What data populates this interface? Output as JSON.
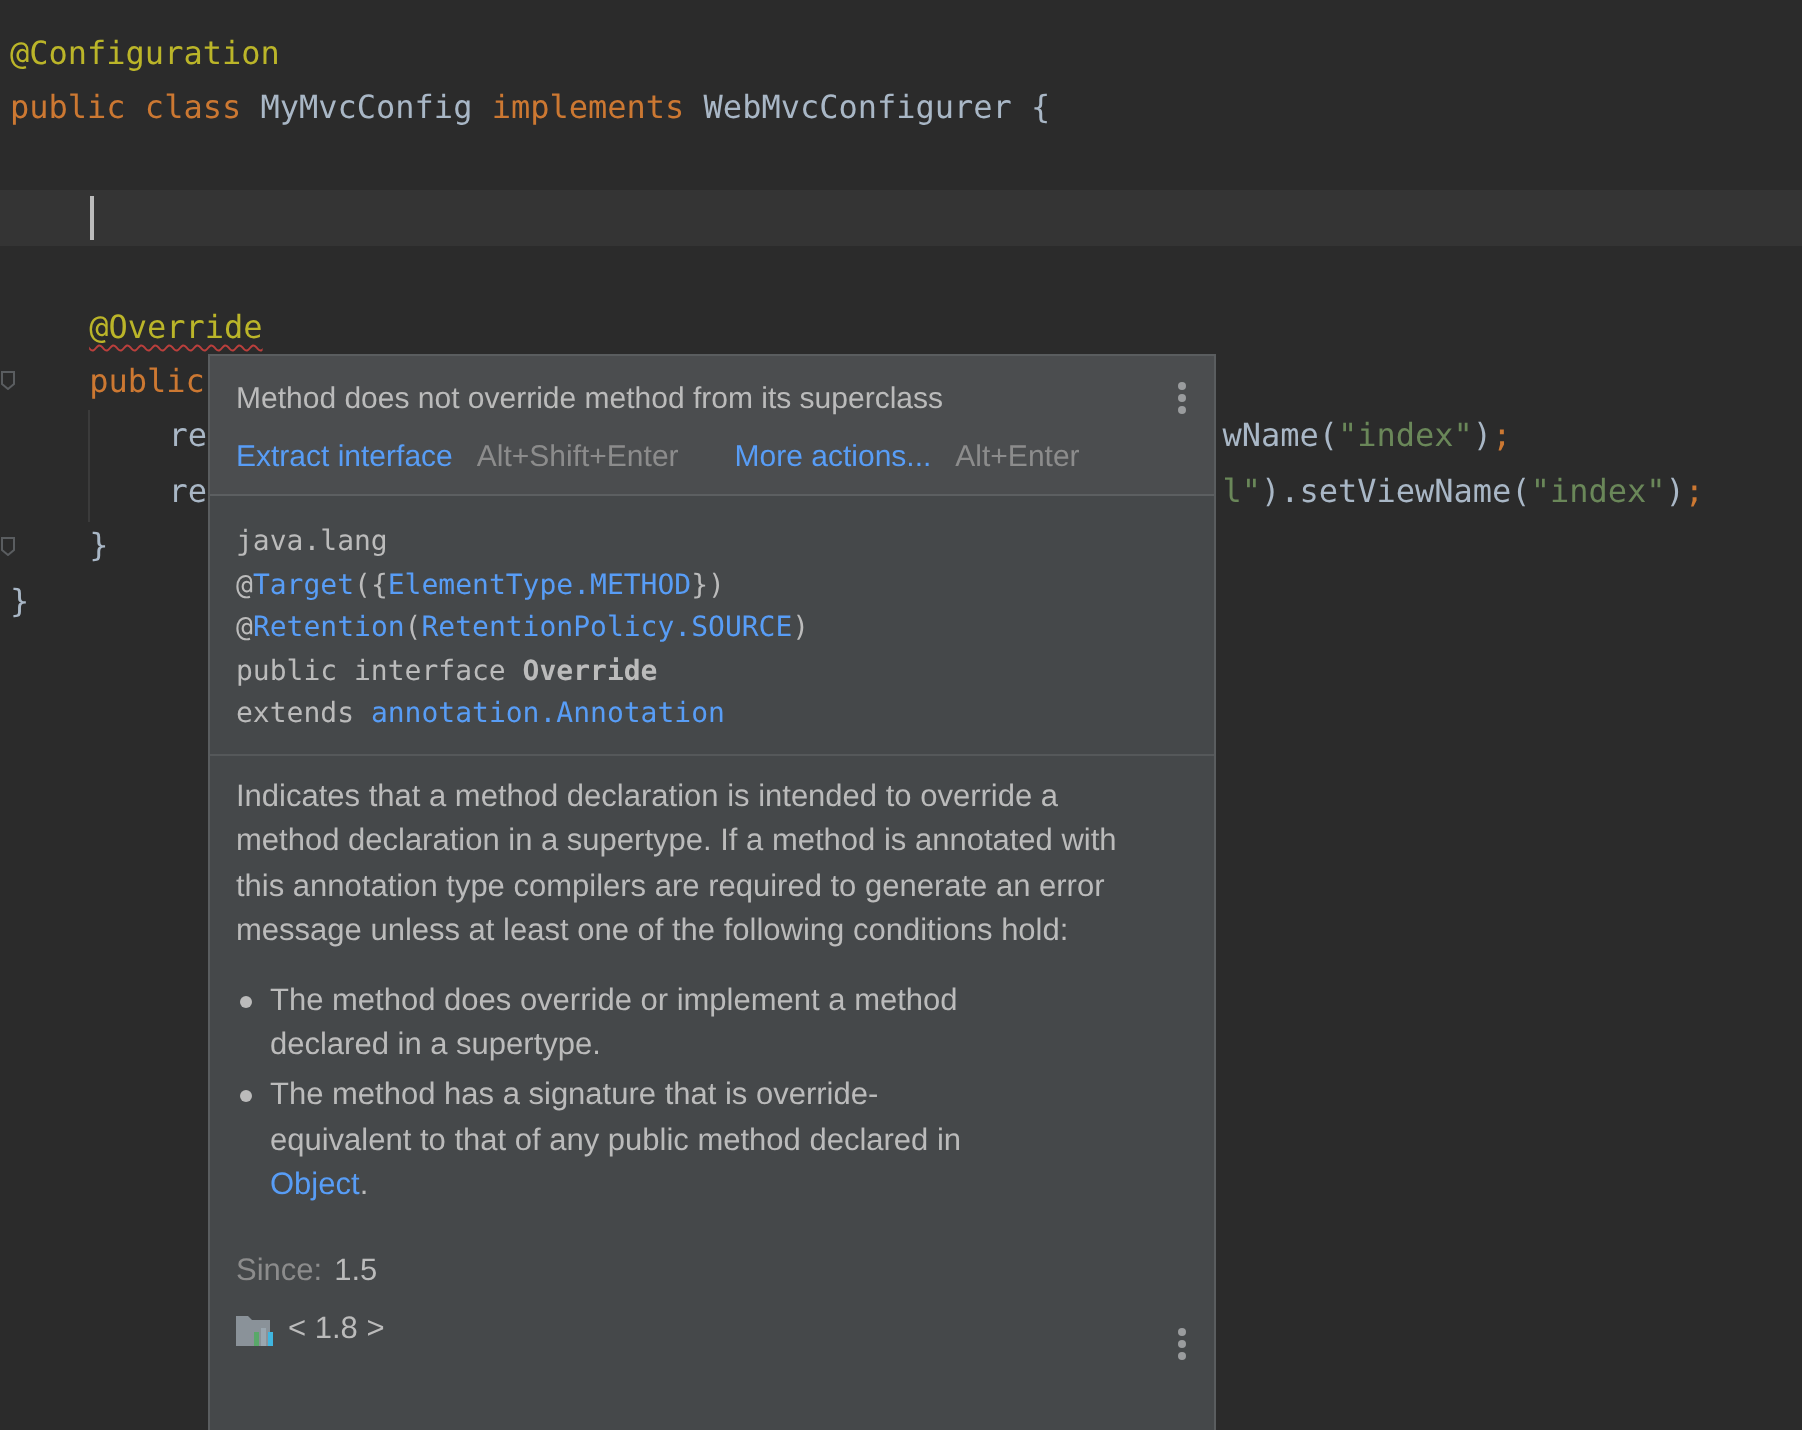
{
  "editor": {
    "lines": [
      {
        "tokens": [
          {
            "text": "@Configuration",
            "kind": "annotation"
          }
        ]
      },
      {
        "tokens": [
          {
            "text": "public class ",
            "kind": "keyword"
          },
          {
            "text": "MyMvcConfig ",
            "kind": "plain"
          },
          {
            "text": "implements ",
            "kind": "keyword"
          },
          {
            "text": "WebMvcConfigurer {",
            "kind": "plain"
          }
        ],
        "children": [
          {
            "kind": "blank"
          },
          {
            "kind": "blank",
            "current": true
          },
          {
            "kind": "blank"
          },
          {
            "tokens": [
              {
                "text": "@Override",
                "kind": "annotation",
                "error": true
              }
            ]
          },
          {
            "tokens": [
              {
                "text": "public",
                "kind": "keyword"
              }
            ],
            "fold": true,
            "children": [
              {
                "tokens": [
                  {
                    "text": "re",
                    "kind": "plain"
                  }
                ],
                "resume": [
                  {
                    "text": "wName(",
                    "kind": "plain"
                  },
                  {
                    "text": "\"index\"",
                    "kind": "string"
                  },
                  {
                    "text": ")",
                    "kind": "plain"
                  },
                  {
                    "text": ";",
                    "kind": "keyword"
                  }
                ]
              },
              {
                "tokens": [
                  {
                    "text": "re",
                    "kind": "plain"
                  }
                ],
                "resume": [
                  {
                    "text": "l\"",
                    "kind": "string"
                  },
                  {
                    "text": ").setViewName(",
                    "kind": "plain"
                  },
                  {
                    "text": "\"index\"",
                    "kind": "string"
                  },
                  {
                    "text": ")",
                    "kind": "plain"
                  },
                  {
                    "text": ";",
                    "kind": "keyword"
                  }
                ]
              }
            ]
          },
          {
            "tokens": [
              {
                "text": "}",
                "kind": "plain"
              }
            ],
            "fold": true
          }
        ]
      },
      {
        "tokens": [
          {
            "text": "}",
            "kind": "plain"
          }
        ]
      }
    ]
  },
  "popup": {
    "title": "Method does not override method from its superclass",
    "actions": [
      {
        "label": "Extract interface",
        "shortcut": "Alt+Shift+Enter"
      },
      {
        "label": "More actions...",
        "shortcut": "Alt+Enter"
      }
    ],
    "signature": [
      [
        {
          "text": "java.lang",
          "kind": "plain"
        }
      ],
      [
        {
          "text": "@",
          "kind": "plain"
        },
        {
          "text": "Target",
          "kind": "link"
        },
        {
          "text": "({",
          "kind": "plain"
        },
        {
          "text": "ElementType.METHOD",
          "kind": "link"
        },
        {
          "text": "})",
          "kind": "plain"
        }
      ],
      [
        {
          "text": "@",
          "kind": "plain"
        },
        {
          "text": "Retention",
          "kind": "link"
        },
        {
          "text": "(",
          "kind": "plain"
        },
        {
          "text": "RetentionPolicy.SOURCE",
          "kind": "link"
        },
        {
          "text": ")",
          "kind": "plain"
        }
      ],
      [
        {
          "text": "public interface ",
          "kind": "plain"
        },
        {
          "text": "Override",
          "kind": "bold"
        }
      ],
      [
        {
          "text": "extends ",
          "kind": "plain"
        },
        {
          "text": "annotation.Annotation",
          "kind": "link"
        }
      ]
    ],
    "description": "Indicates that a method declaration is intended to override a method declaration in a supertype. If a method is annotated with this annotation type compilers are required to generate an error message unless at least one of the following conditions hold:",
    "bullets": [
      [
        {
          "text": "The method does override or implement a method declared in a supertype.",
          "kind": "plain"
        }
      ],
      [
        {
          "text": "The method has a signature that is override-equivalent to that of any public method declared in ",
          "kind": "plain"
        },
        {
          "text": "Object",
          "kind": "link"
        },
        {
          "text": ".",
          "kind": "plain"
        }
      ]
    ],
    "since_label": "Since:",
    "since_value": "1.5",
    "version": "< 1.8 >"
  }
}
